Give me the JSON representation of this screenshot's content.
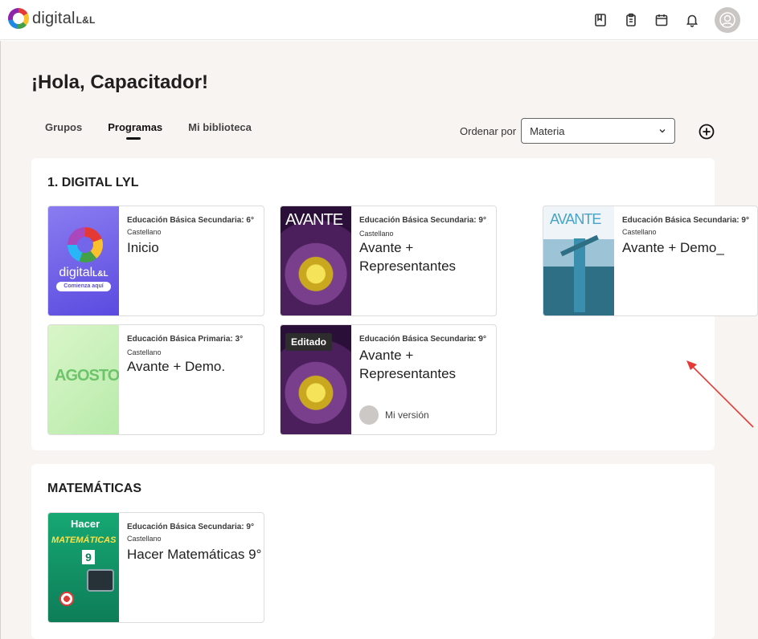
{
  "header": {
    "logo_text": "digital",
    "logo_suffix": "L&L",
    "icons": [
      "book-icon",
      "clipboard-icon",
      "calendar-icon",
      "bell-icon",
      "user-avatar-icon"
    ]
  },
  "greeting": "¡Hola, Capacitador!",
  "tabs": [
    {
      "label": "Grupos",
      "active": false
    },
    {
      "label": "Programas",
      "active": true
    },
    {
      "label": "Mi biblioteca",
      "active": false
    }
  ],
  "sort": {
    "label": "Ordenar por",
    "value": "Materia"
  },
  "sections": [
    {
      "title": "1. DIGITAL LYL",
      "cards": [
        {
          "level": "Educación Básica Secundaria: 6°",
          "lang": "Castellano",
          "title": "Inicio",
          "cover": "digital-lyl-cover"
        },
        {
          "level": "Educación Básica Secundaria: 9°",
          "lang": "Castellano",
          "title": "Avante + Representantes",
          "cover": "avante-flower-cover"
        },
        {
          "level": "Educación Básica Secundaria: 9°",
          "lang": "Castellano",
          "title": "Avante + Demo_",
          "cover": "avante-windmill-cover"
        },
        {
          "level": "Educación Básica Primaria: 3°",
          "lang": "Castellano",
          "title": "Avante + Demo.",
          "cover": "agosto-cover"
        },
        {
          "level": "Educación Básica Secundaria: 9°",
          "lang": "",
          "title": "Avante + Representantes",
          "cover": "avante-flower-cover",
          "badge": "Editado",
          "version": "Mi versión",
          "menu": "···"
        }
      ]
    },
    {
      "title": "MATEMÁTICAS",
      "cards": [
        {
          "level": "Educación Básica Secundaria: 9°",
          "lang": "Castellano",
          "title": "Hacer Matemáticas 9°",
          "cover": "hacer-matematicas-cover"
        }
      ]
    }
  ],
  "covers": {
    "digital": {
      "text": "digital",
      "suffix": "L&L",
      "button": "Comienza aquí"
    },
    "avante": {
      "text": "AVANTE"
    },
    "agosto": {
      "text": "AGOSTO"
    },
    "mate": {
      "top": "Hacer",
      "title": "MATEMÁTICAS",
      "grade": "9"
    }
  },
  "colors": {
    "accent": "#111111",
    "arrow": "#e53935",
    "bg": "#f8f4f1"
  }
}
